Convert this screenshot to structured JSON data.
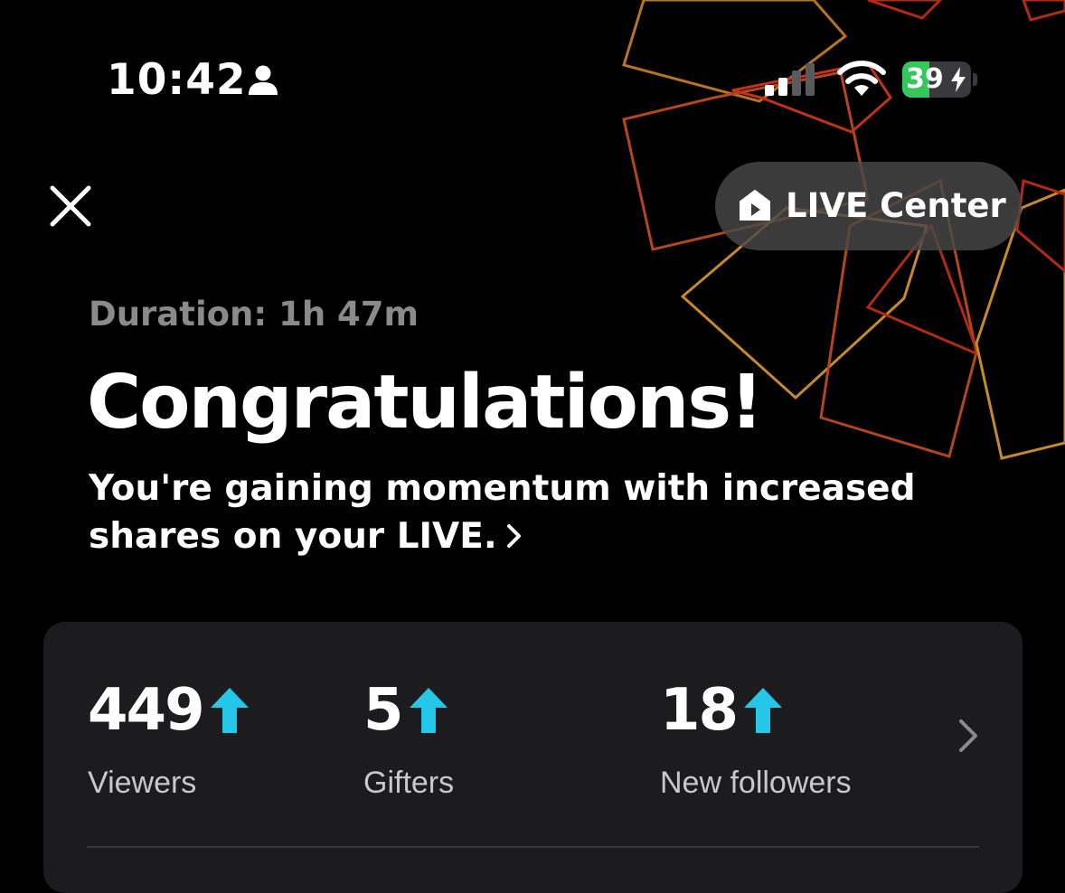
{
  "status_bar": {
    "time": "10:42",
    "battery_level": "39",
    "battery_fraction": 0.39
  },
  "header": {
    "live_center_label": "LIVE Center"
  },
  "summary": {
    "duration": "Duration: 1h 47m",
    "title": "Congratulations!",
    "subtitle": "You're gaining momentum with increased shares on your LIVE."
  },
  "stats": [
    {
      "value": "449",
      "label": "Viewers",
      "trend": "up"
    },
    {
      "value": "5",
      "label": "Gifters",
      "trend": "up"
    },
    {
      "value": "18",
      "label": "New followers",
      "trend": "up"
    }
  ],
  "colors": {
    "background": "#000000",
    "card": "#1c1c1e",
    "trend_up": "#25c7e8",
    "muted_text": "#8a8a8a",
    "battery_green": "#34c759"
  },
  "icons": {
    "close": "close-icon",
    "live_center": "house-icon",
    "trend": "arrow-up-icon",
    "more": "chevron-right-icon"
  }
}
